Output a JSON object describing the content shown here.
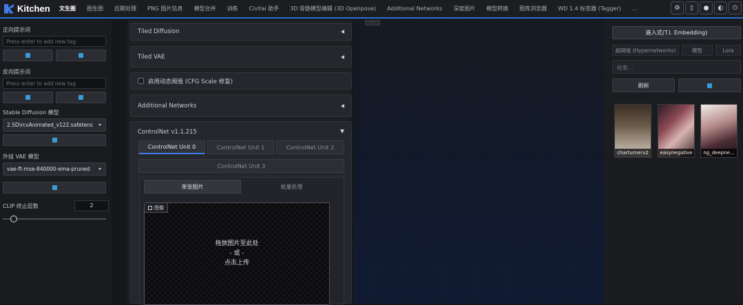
{
  "app": {
    "title": "Kitchen"
  },
  "tabs": [
    "文生图",
    "图生图",
    "后期处理",
    "PNG 图片信息",
    "模型合并",
    "训练",
    "Civitai 助手",
    "3D 骨骼模型编辑 (3D Openpose)",
    "Additional Networks",
    "深度图片",
    "模型转换",
    "图库浏览器",
    "WD 1.4 标签器 (Tagger)",
    "..."
  ],
  "active_tab": "文生图",
  "top_icons": [
    "settings-icon",
    "mobile-icon",
    "github-icon",
    "theme-icon",
    "power-icon"
  ],
  "left": {
    "positive_label": "正向提示词",
    "positive_placeholder": "Press enter to add new tag",
    "negative_label": "反向提示词",
    "negative_placeholder": "Press enter to add new tag",
    "checkpoint_label": "Stable Diffusion 模型",
    "checkpoint_value": "2.5D\\rcvAnimated_v122.safetens",
    "vae_label": "外挂 VAE 模型",
    "vae_value": "vae-ft-mse-840000-ema-pruned",
    "clip_label": "CLIP 终止层数",
    "clip_value": "2",
    "clip_slider_fraction": 0.08
  },
  "mid": {
    "tiled_diffusion": "Tiled Diffusion",
    "tiled_vae": "Tiled VAE",
    "dynamic_cfg": "启用动态阈值 (CFG Scale 修复)",
    "additional_networks": "Additional Networks",
    "controlnet_title": "ControlNet v1.1.215",
    "units": [
      "ControlNet Unit 0",
      "ControlNet Unit 1",
      "ControlNet Unit 2",
      "ControlNet Unit 3"
    ],
    "subtabs": [
      "单张图片",
      "批量处理"
    ],
    "image_badge": "图像",
    "drop_line1": "拖放图片至此处",
    "drop_line2": "- 或 -",
    "drop_line3": "点击上传"
  },
  "right": {
    "embedding_tab": "嵌入式(T.I. Embedding)",
    "tabs": [
      "超网络 (Hypernetworks)",
      "模型",
      "Lora"
    ],
    "search_placeholder": "检索...",
    "refresh": "刷新",
    "cards": [
      "charturnerv2",
      "easynegative",
      "ng_deepne..."
    ]
  }
}
